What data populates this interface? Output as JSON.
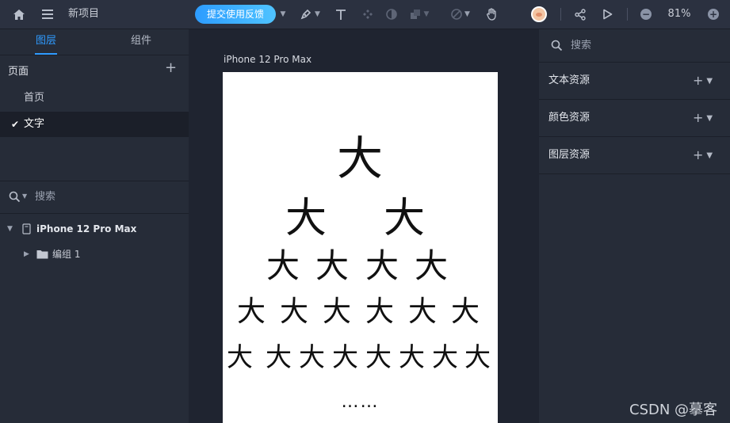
{
  "toolbar": {
    "project_title": "新项目",
    "feedback_label": "提交使用反馈",
    "zoom_level": "81%",
    "icons": [
      "home-icon",
      "menu-icon",
      "pen-icon",
      "text-tool-icon",
      "component-icon",
      "mask-icon",
      "boolean-icon",
      "disable-icon",
      "hand-icon",
      "avatar",
      "share-icon",
      "play-icon",
      "zoom-out-icon",
      "zoom-in-icon"
    ]
  },
  "left_panel": {
    "tabs": [
      {
        "label": "图层"
      },
      {
        "label": "组件"
      }
    ],
    "pages": {
      "heading": "页面",
      "items": [
        {
          "label": "首页"
        },
        {
          "label": "文字"
        }
      ]
    },
    "layers": {
      "search_placeholder": "搜索",
      "artboard": "iPhone 12 Pro Max",
      "group": "编组 1"
    }
  },
  "canvas": {
    "artboard_label": "iPhone 12 Pro Max",
    "glyph": "大",
    "ellipsis": "……"
  },
  "right_panel": {
    "search_placeholder": "搜索",
    "sections": [
      {
        "label": "文本资源"
      },
      {
        "label": "颜色资源"
      },
      {
        "label": "图层资源"
      }
    ]
  },
  "watermark": "CSDN @摹客",
  "colors": {
    "accent": "#2f9bff",
    "toolbar_bg": "#2b3140",
    "panel_bg": "#262c38",
    "canvas_bg": "#1f2430"
  }
}
